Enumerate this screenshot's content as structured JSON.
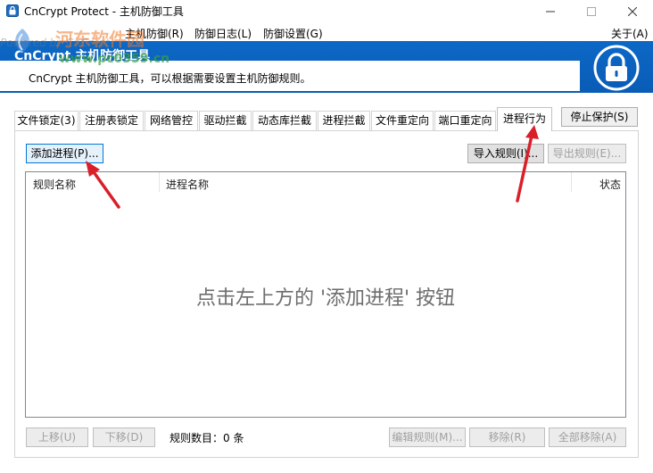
{
  "window": {
    "title": "CnCrypt Protect - 主机防御工具"
  },
  "watermark": {
    "site_name": "河东软件园",
    "powered_by": "Powered by CnCrypt",
    "url": "www.pc0359.cn"
  },
  "menu": {
    "file": "主机防御(R)",
    "host_defense": "主机防御(R)",
    "defense_log": "防御日志(L)",
    "defense_settings": "防御设置(G)",
    "about": "关于(A)"
  },
  "banner": {
    "title": "CnCrypt 主机防御工具",
    "subtitle": "CnCrypt 主机防御工具，可以根据需要设置主机防御规则。"
  },
  "tabs": [
    {
      "label": "文件锁定(3)"
    },
    {
      "label": "注册表锁定"
    },
    {
      "label": "网络管控"
    },
    {
      "label": "驱动拦截"
    },
    {
      "label": "动态库拦截"
    },
    {
      "label": "进程拦截"
    },
    {
      "label": "文件重定向"
    },
    {
      "label": "端口重定向"
    },
    {
      "label": "进程行为"
    }
  ],
  "toolbar": {
    "stop_protect": "停止保护(S)",
    "add_process": "添加进程(P)...",
    "import_rules": "导入规则(I)...",
    "export_rules": "导出规则(E)..."
  },
  "list": {
    "columns": [
      "规则名称",
      "进程名称",
      "状态"
    ],
    "empty_hint": "点击左上方的 '添加进程' 按钮"
  },
  "footer": {
    "move_up": "上移(U)",
    "move_down": "下移(D)",
    "rule_count": "规则数目：0 条",
    "edit_rule": "编辑规则(M)...",
    "remove": "移除(R)",
    "remove_all": "全部移除(A)"
  },
  "colors": {
    "banner_blue": "#0a5cb6",
    "arrow_red": "#d9202a",
    "focus_blue": "#0078d7"
  }
}
